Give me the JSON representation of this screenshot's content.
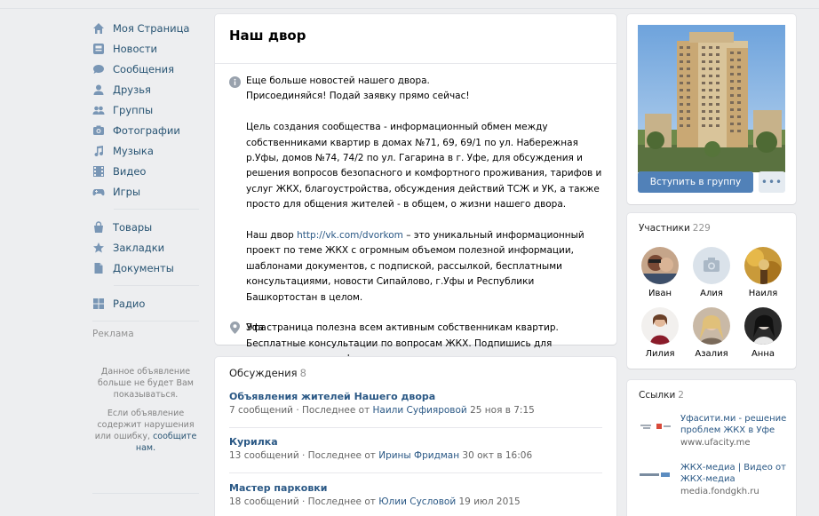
{
  "sidebar": {
    "items": [
      {
        "label": "Моя Страница",
        "icon": "home-icon"
      },
      {
        "label": "Новости",
        "icon": "news-icon"
      },
      {
        "label": "Сообщения",
        "icon": "messages-icon"
      },
      {
        "label": "Друзья",
        "icon": "friends-icon"
      },
      {
        "label": "Группы",
        "icon": "groups-icon"
      },
      {
        "label": "Фотографии",
        "icon": "photos-icon"
      },
      {
        "label": "Музыка",
        "icon": "music-icon"
      },
      {
        "label": "Видео",
        "icon": "video-icon"
      },
      {
        "label": "Игры",
        "icon": "games-icon"
      }
    ],
    "items2": [
      {
        "label": "Товары",
        "icon": "goods-icon"
      },
      {
        "label": "Закладки",
        "icon": "bookmarks-icon"
      },
      {
        "label": "Документы",
        "icon": "documents-icon"
      }
    ],
    "items3": [
      {
        "label": "Радио",
        "icon": "radio-icon"
      }
    ],
    "ads_link": "Реклама",
    "ad_notice_1": "Данное объявление больше не будет Вам показываться.",
    "ad_notice_2a": "Если объявление содержит нарушения или ошибку,",
    "ad_notice_2b": "сообщите нам."
  },
  "group": {
    "title": "Наш двор",
    "desc_p1_l1": "Еще больше новостей нашего двора.",
    "desc_p1_l2": "Присоединяйся! Подай заявку прямо сейчас!",
    "desc_p2": "Цель создания сообщества - информационный обмен между собственниками квартир в домах №71, 69, 69/1 по ул. Набережная р.Уфы, домов №74, 74/2 по ул. Гагарина в г. Уфе, для обсуждения и решения вопросов безопасного и комфортного проживания, тарифов и услуг ЖКХ, благоустройства, обсуждения действий ТСЖ и УК, а также просто для общения жителей - в общем, о жизни нашего двора.",
    "desc_p3_pre": "Наш двор ",
    "desc_p3_link": "http://vk.com/dvorkom",
    "desc_p3_post": " – это уникальный информационный проект по теме ЖКХ с огромным объемом полезной информации, шаблонами документов, с подпиской, рассылкой, бесплатными консультациями, новости Сипайлово, г.Уфы и Республики Башкортостан в целом.",
    "desc_p4": "Эта страница полезна всем активным собственникам квартир. Бесплатные консультации по вопросам ЖКХ. Подпишись для получения полного функционала.",
    "location": "Уфа"
  },
  "discussions": {
    "label": "Обсуждения",
    "count": "8",
    "items": [
      {
        "title": "Объявления жителей Нашего двора",
        "count": "7 сообщений",
        "sep": " · Последнее от ",
        "author": "Наили Суфияровой",
        "date": " 25 ноя в 7:15"
      },
      {
        "title": "Курилка",
        "count": "13 сообщений",
        "sep": " · Последнее от ",
        "author": "Ирины Фридман",
        "date": " 30 окт в 16:06"
      },
      {
        "title": "Мастер парковки",
        "count": "18 сообщений",
        "sep": " · Последнее от ",
        "author": "Юлии Сусловой",
        "date": " 19 июл 2015"
      }
    ]
  },
  "actions": {
    "join_label": "Вступить в группу",
    "more_label": "•••"
  },
  "members": {
    "label": "Участники",
    "count": "229",
    "items": [
      {
        "name": "Иван"
      },
      {
        "name": "Алия"
      },
      {
        "name": "Наиля"
      },
      {
        "name": "Лилия"
      },
      {
        "name": "Азалия"
      },
      {
        "name": "Анна"
      }
    ]
  },
  "links": {
    "label": "Ссылки",
    "count": "2",
    "items": [
      {
        "title": "Уфасити.ми - решение проблем ЖКХ в Уфе",
        "url": "www.ufacity.me"
      },
      {
        "title": "ЖКХ-медиа | Видео от ЖКХ-медиа",
        "url": "media.fondgkh.ru"
      }
    ]
  },
  "colors": {
    "accent": "#5181b8",
    "link": "#2a5885",
    "background": "#edeef0"
  }
}
